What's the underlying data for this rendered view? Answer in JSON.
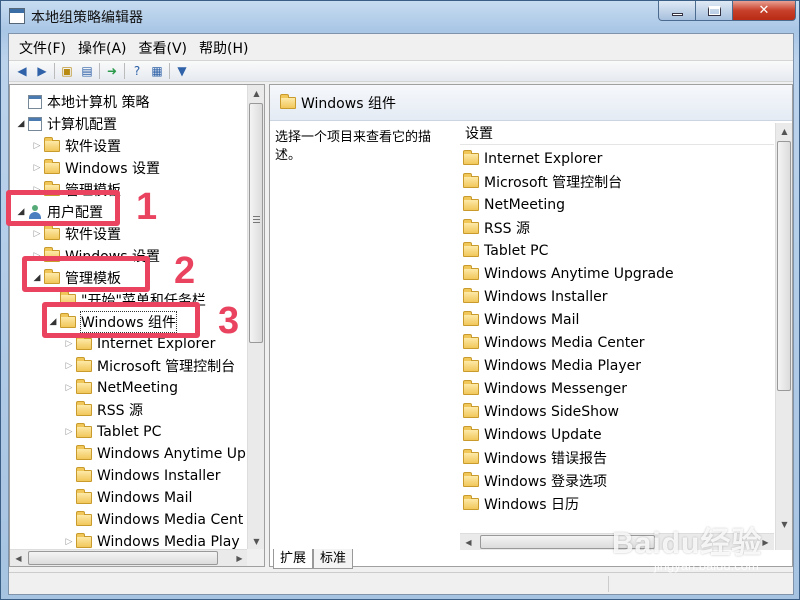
{
  "window": {
    "title": "本地组策略编辑器"
  },
  "menu": [
    "文件(F)",
    "操作(A)",
    "查看(V)",
    "帮助(H)"
  ],
  "toolbar_icons": [
    "back-arrow-icon",
    "forward-arrow-icon",
    "up-folder-icon",
    "show-hide-tree-icon",
    "export-list-icon",
    "help-icon",
    "properties-icon",
    "filter-icon"
  ],
  "tree": [
    {
      "label": "本地计算机 策略",
      "icon": "policy-icon",
      "arrow": ""
    },
    {
      "label": "计算机配置",
      "icon": "computer-icon",
      "arrow": "▲"
    },
    {
      "label": "软件设置",
      "icon": "folder-icon",
      "arrow": "▷"
    },
    {
      "label": "Windows 设置",
      "icon": "folder-icon",
      "arrow": "▷"
    },
    {
      "label": "管理模板",
      "icon": "folder-icon",
      "arrow": "▷"
    },
    {
      "label": "用户配置",
      "icon": "user-icon",
      "arrow": "▲"
    },
    {
      "label": "软件设置",
      "icon": "folder-icon",
      "arrow": "▷"
    },
    {
      "label": "Windows 设置",
      "icon": "folder-icon",
      "arrow": "▷"
    },
    {
      "label": "管理模板",
      "icon": "folder-icon",
      "arrow": "▲"
    },
    {
      "label": "\"开始\"菜单和任务栏",
      "icon": "folder-icon",
      "arrow": ""
    },
    {
      "label": "Windows 组件",
      "icon": "folder-icon",
      "arrow": "▲"
    },
    {
      "label": "Internet Explorer",
      "icon": "folder-icon",
      "arrow": "▷"
    },
    {
      "label": "Microsoft 管理控制台",
      "icon": "folder-icon",
      "arrow": "▷"
    },
    {
      "label": "NetMeeting",
      "icon": "folder-icon",
      "arrow": "▷"
    },
    {
      "label": "RSS 源",
      "icon": "folder-icon",
      "arrow": ""
    },
    {
      "label": "Tablet PC",
      "icon": "folder-icon",
      "arrow": "▷"
    },
    {
      "label": "Windows Anytime Up",
      "icon": "folder-icon",
      "arrow": ""
    },
    {
      "label": "Windows Installer",
      "icon": "folder-icon",
      "arrow": ""
    },
    {
      "label": "Windows Mail",
      "icon": "folder-icon",
      "arrow": ""
    },
    {
      "label": "Windows Media Cent",
      "icon": "folder-icon",
      "arrow": ""
    },
    {
      "label": "Windows Media Play",
      "icon": "folder-icon",
      "arrow": "▷"
    }
  ],
  "right": {
    "header": "Windows 组件",
    "description": "选择一个项目来查看它的描述。",
    "column": "设置",
    "items": [
      "Internet Explorer",
      "Microsoft 管理控制台",
      "NetMeeting",
      "RSS 源",
      "Tablet PC",
      "Windows Anytime Upgrade",
      "Windows Installer",
      "Windows Mail",
      "Windows Media Center",
      "Windows Media Player",
      "Windows Messenger",
      "Windows SideShow",
      "Windows Update",
      "Windows 错误报告",
      "Windows 登录选项",
      "Windows 日历"
    ]
  },
  "tabs": [
    "扩展",
    "标准"
  ],
  "annotations": [
    "1",
    "2",
    "3"
  ],
  "watermark": {
    "brand": "Baidu经验",
    "site": "jingyan.baidu.com"
  },
  "colors": {
    "callout": "#e9435f",
    "folder": "#f1c75a"
  }
}
